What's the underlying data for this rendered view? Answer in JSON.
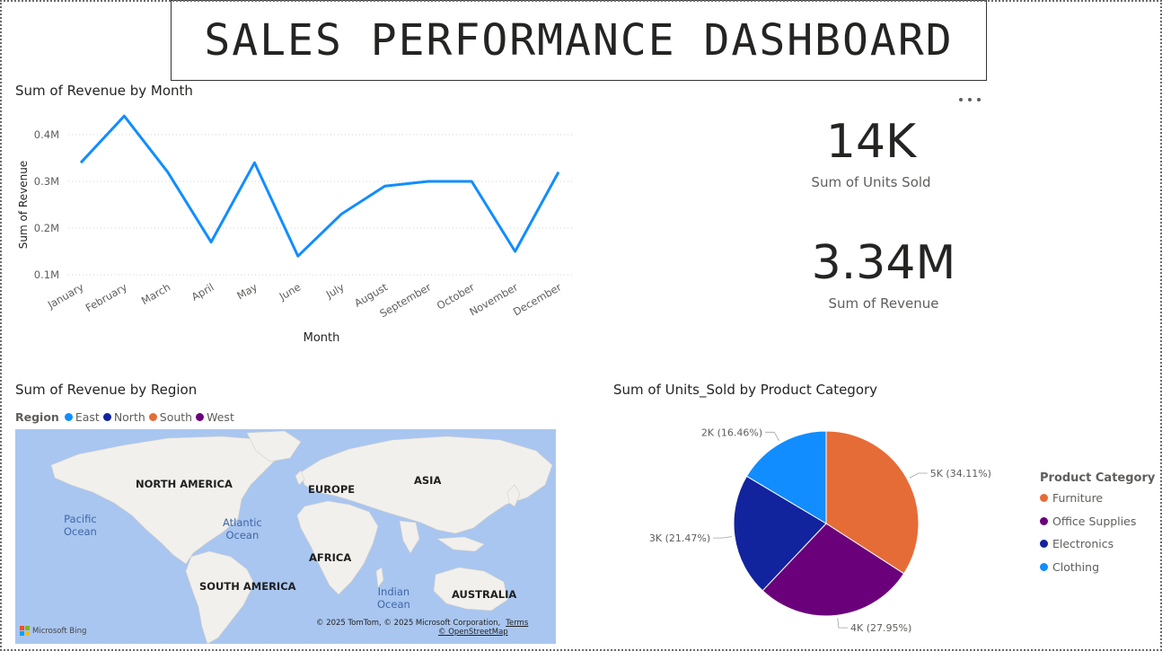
{
  "dashboard": {
    "title": "SALES PERFORMANCE DASHBOARD"
  },
  "line_visual": {
    "title": "Sum of Revenue by Month",
    "more_icon": "more-options-icon"
  },
  "cards": {
    "units": {
      "value": "14K",
      "label": "Sum of Units Sold"
    },
    "revenue": {
      "value": "3.34M",
      "label": "Sum of Revenue"
    }
  },
  "map_visual": {
    "title": "Sum of Revenue by Region",
    "legend_title": "Region",
    "legend": [
      {
        "label": "East",
        "color": "#118dff"
      },
      {
        "label": "North",
        "color": "#12239e"
      },
      {
        "label": "South",
        "color": "#e66c37"
      },
      {
        "label": "West",
        "color": "#6b007b"
      }
    ],
    "continents": [
      {
        "key": "na",
        "label": "NORTH AMERICA"
      },
      {
        "key": "eu",
        "label": "EUROPE"
      },
      {
        "key": "as",
        "label": "ASIA"
      },
      {
        "key": "af",
        "label": "AFRICA"
      },
      {
        "key": "sa",
        "label": "SOUTH AMERICA"
      },
      {
        "key": "au",
        "label": "AUSTRALIA"
      }
    ],
    "oceans": [
      {
        "key": "pac",
        "label": "Pacific\nOcean"
      },
      {
        "key": "atl",
        "label": "Atlantic\nOcean"
      },
      {
        "key": "ind",
        "label": "Indian\nOcean"
      }
    ],
    "attribution": "© 2025 TomTom, © 2025 Microsoft Corporation,",
    "terms": "Terms",
    "osm": "© OpenStreetMap",
    "provider": "Microsoft Bing"
  },
  "pie_visual": {
    "title": "Sum of Units_Sold by Product Category",
    "legend_title": "Product Category"
  },
  "chart_data": [
    {
      "type": "line",
      "title": "Sum of Revenue by Month",
      "xlabel": "Month",
      "ylabel": "Sum of Revenue",
      "categories": [
        "January",
        "February",
        "March",
        "April",
        "May",
        "June",
        "July",
        "August",
        "September",
        "October",
        "November",
        "December"
      ],
      "series": [
        {
          "values": [
            0.34,
            0.44,
            0.32,
            0.17,
            0.34,
            0.14,
            0.23,
            0.29,
            0.3,
            0.3,
            0.15,
            0.32
          ],
          "color": "#118dff"
        }
      ],
      "value_unit": "M",
      "yticks": [
        "0.1M",
        "0.2M",
        "0.3M",
        "0.4M"
      ],
      "ylim": [
        0.1,
        0.4
      ],
      "grid": true
    },
    {
      "type": "pie",
      "title": "Sum of Units_Sold by Product Category",
      "legend_title": "Product Category",
      "legend_placement": "right",
      "slices": [
        {
          "label": "Furniture",
          "value": 34.11,
          "data_label": "5K (34.11%)",
          "color": "#e66c37"
        },
        {
          "label": "Office Supplies",
          "value": 27.95,
          "data_label": "4K (27.95%)",
          "color": "#6b007b"
        },
        {
          "label": "Electronics",
          "value": 21.47,
          "data_label": "3K (21.47%)",
          "color": "#12239e"
        },
        {
          "label": "Clothing",
          "value": 16.46,
          "data_label": "2K (16.46%)",
          "color": "#118dff"
        }
      ]
    }
  ]
}
